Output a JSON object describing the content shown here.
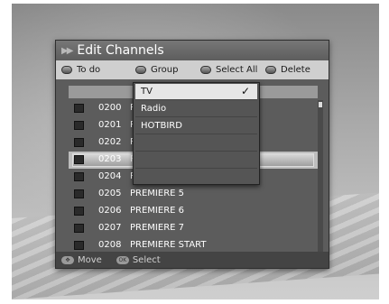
{
  "title": "Edit Channels",
  "functions": {
    "todo": "To do",
    "group": "Group",
    "select_all": "Select All",
    "delete": "Delete"
  },
  "channels": [
    {
      "num": "0200",
      "name": "P"
    },
    {
      "num": "0201",
      "name": "P"
    },
    {
      "num": "0202",
      "name": "P"
    },
    {
      "num": "0203",
      "name": "P"
    },
    {
      "num": "0204",
      "name": "P"
    },
    {
      "num": "0205",
      "name": "PREMIERE 5"
    },
    {
      "num": "0206",
      "name": "PREMIERE 6"
    },
    {
      "num": "0207",
      "name": "PREMIERE 7"
    },
    {
      "num": "0208",
      "name": "PREMIERE START"
    }
  ],
  "group_menu": {
    "items": [
      "TV",
      "Radio",
      "HOTBIRD"
    ],
    "selected": "TV",
    "check_glyph": "✓"
  },
  "footer": {
    "move": "Move",
    "select": "Select",
    "ok_glyph": "OK"
  }
}
